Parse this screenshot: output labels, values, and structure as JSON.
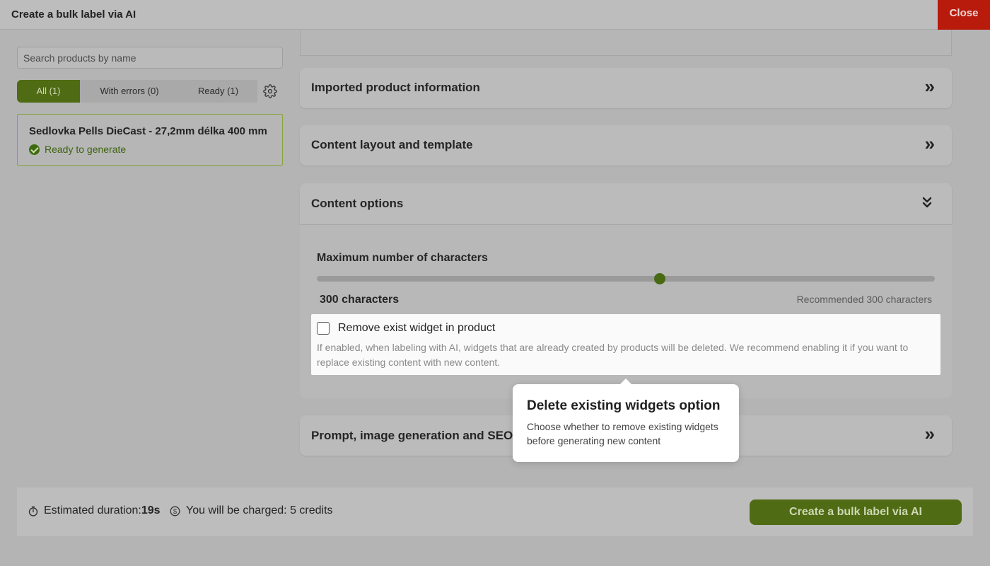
{
  "window": {
    "title": "Create a bulk label via AI",
    "close_label": "Close"
  },
  "sidebar": {
    "search_placeholder": "Search products by name",
    "tabs": [
      {
        "label": "All (1)",
        "active": true
      },
      {
        "label": "With errors (0)",
        "active": false
      },
      {
        "label": "Ready (1)",
        "active": false
      }
    ],
    "products": [
      {
        "name": "Sedlovka Pells DieCast - 27,2mm délka 400 mm",
        "status": "Ready to generate"
      }
    ]
  },
  "sections": {
    "imported": {
      "title": "Imported product information",
      "icon": "chevrons-right-icon"
    },
    "layout": {
      "title": "Content layout and template",
      "icon": "chevrons-right-icon"
    },
    "options": {
      "title": "Content options",
      "icon": "chevrons-down-icon"
    },
    "prompt": {
      "title": "Prompt, image generation and SEO s",
      "icon": "chevrons-right-icon"
    }
  },
  "content_options": {
    "max_chars_label": "Maximum number of characters",
    "slider_fraction": 0.555,
    "current_value_text": "300 characters",
    "recommended_text": "Recommended 300 characters",
    "remove_widget": {
      "label": "Remove exist widget in product",
      "checked": false,
      "description": "If enabled, when labeling with AI, widgets that are already created by products will be deleted. We recommend enabling it if you want to replace existing content with new content."
    }
  },
  "tooltip": {
    "title": "Delete existing widgets option",
    "body": "Choose whether to remove existing widgets before generating new content"
  },
  "footer": {
    "duration_label": "Estimated duration:",
    "duration_value": "19s",
    "charge_label": "You will be charged:",
    "charge_value": "5 credits",
    "create_button": "Create a bulk label via AI"
  },
  "colors": {
    "accent": "#4f6b14",
    "close": "#b81a0c",
    "success": "#3e6b10"
  }
}
